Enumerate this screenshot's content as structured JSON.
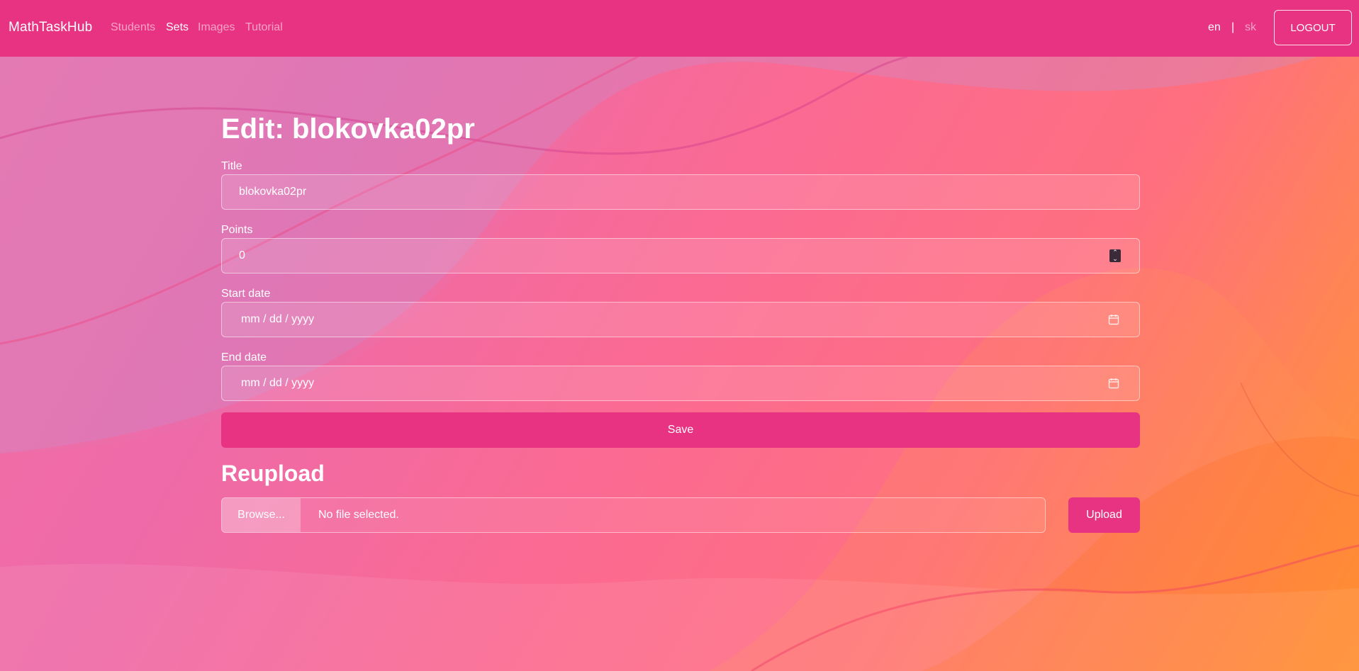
{
  "navbar": {
    "brand": "MathTaskHub",
    "links": [
      {
        "label": "Students",
        "active": false
      },
      {
        "label": "Sets",
        "active": true
      },
      {
        "label": "Images",
        "active": false
      },
      {
        "label": "Tutorial",
        "active": false
      }
    ],
    "languages": [
      {
        "label": "en",
        "active": true
      },
      {
        "label": "sk",
        "active": false
      }
    ],
    "separator": "|",
    "logout_label": "LOGOUT"
  },
  "page": {
    "title": "Edit: blokovka02pr"
  },
  "form": {
    "title_label": "Title",
    "title_value": "blokovka02pr",
    "points_label": "Points",
    "points_value": "0",
    "start_date_label": "Start date",
    "start_date_placeholder": "mm / dd / yyyy",
    "end_date_label": "End date",
    "end_date_placeholder": "mm / dd / yyyy",
    "save_label": "Save"
  },
  "reupload": {
    "title": "Reupload",
    "browse_label": "Browse...",
    "file_status": "No file selected.",
    "upload_label": "Upload"
  },
  "colors": {
    "accent": "#e83383",
    "text": "#ffffff"
  }
}
